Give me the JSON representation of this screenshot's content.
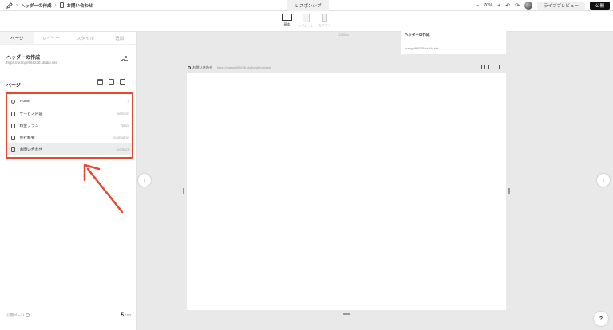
{
  "topbar": {
    "breadcrumb_site": "ヘッダーの作成",
    "breadcrumb_page": "お問い合わせ",
    "responsive_tab": "レスポンシブ",
    "zoom_out": "−",
    "zoom": "70%",
    "zoom_in": "+",
    "undo": "↶",
    "redo": "↷",
    "live_preview": "ライブプレビュー",
    "publish": "公開"
  },
  "devices": [
    {
      "label": "基本",
      "icon": "desktop-icon",
      "active": true
    },
    {
      "label": "タブレット",
      "icon": "tablet-icon",
      "active": false
    },
    {
      "label": "モバイル",
      "icon": "mobile-icon",
      "active": false
    }
  ],
  "sidebar": {
    "tabs": [
      "ページ",
      "レイヤー",
      "スタイル",
      "追加"
    ],
    "site_title": "ヘッダーの作成",
    "site_url": "https://orange869228.studio.site",
    "pages_heading": "ページ",
    "pages": [
      {
        "label": "Home",
        "slug": "/",
        "icon": "home-icon"
      },
      {
        "label": "サービス内容",
        "slug": "/service",
        "icon": "page-icon"
      },
      {
        "label": "料金プラン",
        "slug": "/plan",
        "icon": "page-icon"
      },
      {
        "label": "会社概要",
        "slug": "/company",
        "icon": "page-icon"
      },
      {
        "label": "お問い合わせ",
        "slug": "/contact",
        "icon": "page-icon"
      }
    ],
    "selected_page_index": 4,
    "footer_label": "公開ページ",
    "page_count": "5",
    "page_count_total": "/ 50",
    "page_count_fraction": 0.1
  },
  "canvas": {
    "width_label": "1280px",
    "top_preview_title": "ヘッダーの作成",
    "top_preview_url": "orange869228.studio.site",
    "frame_title": "お問い合わせ",
    "frame_url": "https://orange869228.studio.site/contact",
    "help": "?"
  },
  "colors": {
    "highlight": "#e4482f",
    "accent": "#111111"
  }
}
